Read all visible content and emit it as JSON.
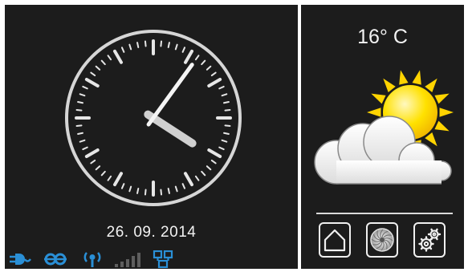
{
  "clock": {
    "date": "26. 09. 2014",
    "hour": 4,
    "minute": 6
  },
  "weather": {
    "temperature": "16° C",
    "condition_icon": "partly-cloudy-icon"
  },
  "status_icons": [
    "plug-icon",
    "link-icon",
    "antenna-icon",
    "signal-strength-icon",
    "network-icon"
  ],
  "nav_buttons": [
    {
      "icon": "home-icon"
    },
    {
      "icon": "fan-icon"
    },
    {
      "icon": "gears-icon"
    }
  ],
  "colors": {
    "panel_background": "#1c1c1c",
    "status_icon_blue": "#2a8fd6",
    "sun_yellow": "#ffd400",
    "clock_face": "#e6e6e6"
  }
}
